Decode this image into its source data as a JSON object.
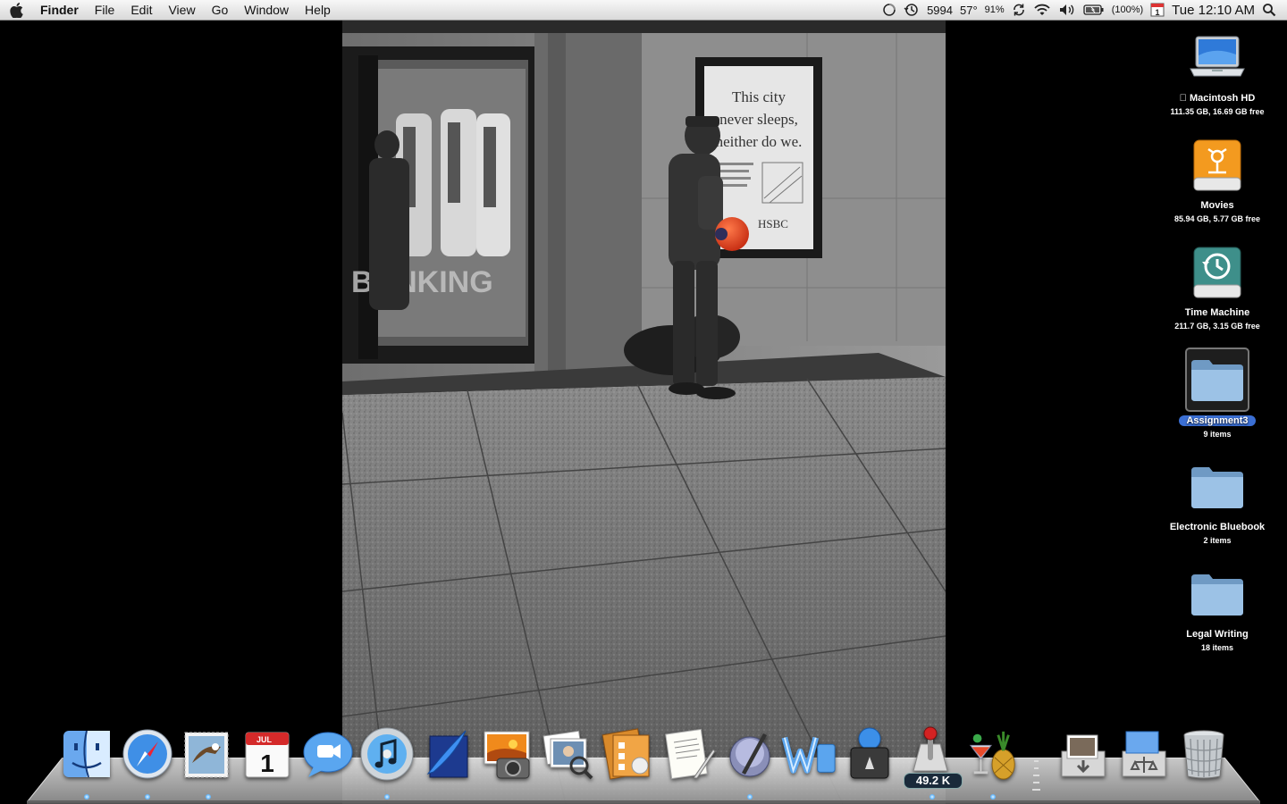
{
  "menubar": {
    "apple_icon": "apple-logo",
    "app_name": "Finder",
    "menus": [
      "File",
      "Edit",
      "View",
      "Go",
      "Window",
      "Help"
    ],
    "status": {
      "counter": "5994",
      "temperature": "57°",
      "cpu_percent": "91%",
      "battery_percent": "(100%)",
      "calendar_day": "1",
      "clock": "Tue 12:10 AM"
    }
  },
  "wallpaper": {
    "poster_line1": "This city",
    "poster_line2": "never sleeps,",
    "poster_line3": "neither do we.",
    "poster_brand": "HSBC",
    "window_text": "BANKING"
  },
  "desktop": {
    "icons": [
      {
        "name": "Macintosh HD",
        "info": "111.35 GB, 16.69 GB free",
        "icon": "laptop-drive-icon"
      },
      {
        "name": "Movies",
        "info": "85.94 GB, 5.77 GB free",
        "icon": "firewire-drive-icon"
      },
      {
        "name": "Time Machine",
        "info": "211.7 GB, 3.15 GB free",
        "icon": "time-machine-drive-icon"
      },
      {
        "name": "Assignment3",
        "info": "9 items",
        "icon": "folder-icon",
        "selected": true
      },
      {
        "name": "Electronic Bluebook",
        "info": "2 items",
        "icon": "folder-icon"
      },
      {
        "name": "Legal Writing",
        "info": "18 items",
        "icon": "folder-icon"
      }
    ]
  },
  "dock": {
    "apps": [
      "Finder",
      "Safari",
      "Mail",
      "iCal",
      "iChat",
      "iTunes",
      "Scrivener",
      "iPhoto",
      "iPhoto Library Manager",
      "OmniFocus",
      "TextEdit",
      "Script Editor",
      "Word",
      "Time Machine Backup",
      "Network Monitor",
      "Adium"
    ],
    "network_badge": "49.2 K",
    "calendar_month": "JUL",
    "calendar_day": "1",
    "stacks": [
      "Downloads",
      "Applications"
    ],
    "trash": "Trash"
  }
}
